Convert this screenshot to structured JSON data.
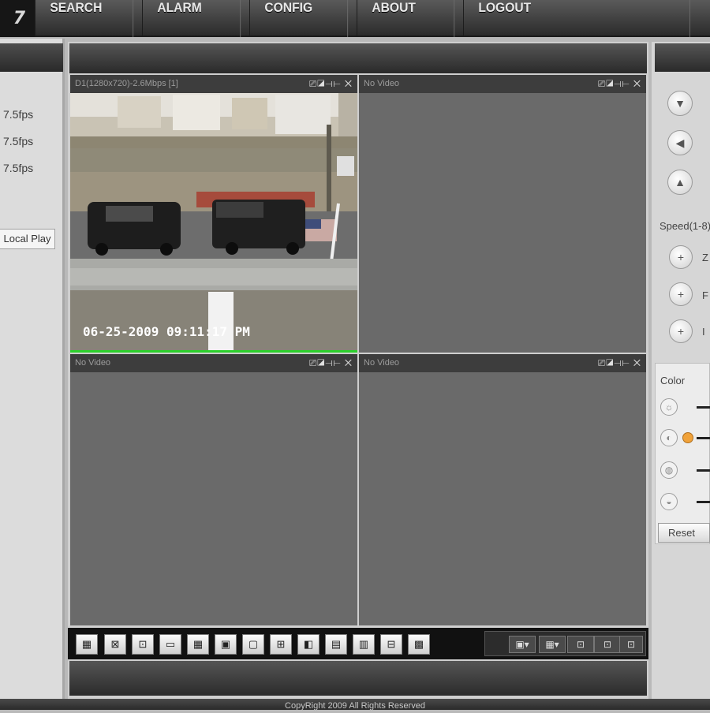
{
  "header": {
    "logo_text": "7",
    "nav": [
      "SEARCH",
      "ALARM",
      "CONFIG",
      "ABOUT",
      "LOGOUT"
    ]
  },
  "left_panel": {
    "rates": [
      "7.5fps",
      "7.5fps",
      "7.5fps"
    ],
    "local_play_label": "Local Play"
  },
  "video": {
    "panes": [
      {
        "title": "D1(1280x720)-2.6Mbps [1]",
        "controls": "⎚◪⊣⊢ ✕"
      },
      {
        "title": "No Video",
        "controls": "⎚◪⊣⊢ ✕"
      },
      {
        "title": "No Video",
        "controls": "⎚◪⊣⊢ ✕"
      },
      {
        "title": "No Video",
        "controls": "⎚◪⊣⊢ ✕"
      }
    ],
    "timestamp": "06-25-2009 09:11:17 PM",
    "active_pane_color": "#2bd12b"
  },
  "toolbar": {
    "buttons": [
      "▦",
      "⊠",
      "⊡",
      "▭",
      "▦",
      "▣",
      "▢",
      "⊞",
      "◧",
      "▤",
      "▥",
      "⊟",
      "▩"
    ],
    "right_controls": [
      "▣▾",
      "▦▾",
      "⊡",
      "⊡",
      "⊡"
    ]
  },
  "right_panel": {
    "ptz_buttons": [
      "▼",
      "◀",
      "▲"
    ],
    "speed_label": "Speed(1-8)",
    "zoom_labels": [
      "Z",
      "F",
      "I"
    ],
    "color_label": "Color",
    "reset_label": "Reset"
  },
  "footer": {
    "copyright": "CopyRight 2009 All Rights Reserved"
  }
}
